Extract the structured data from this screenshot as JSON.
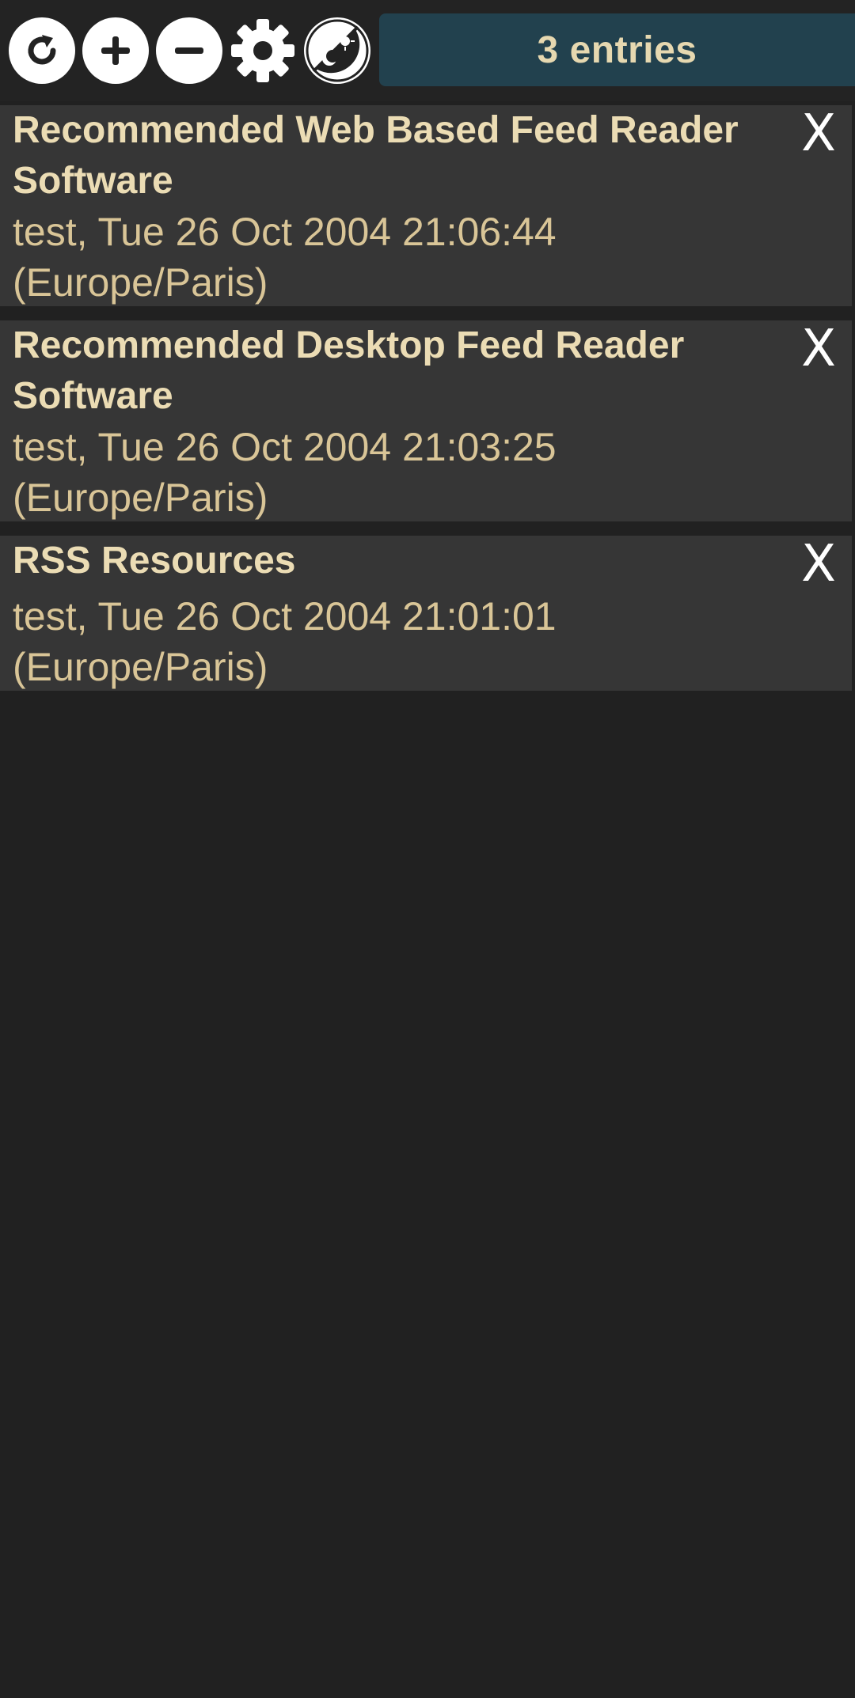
{
  "toolbar": {
    "entries_label": "3 entries",
    "buttons": [
      {
        "name": "refresh",
        "icon": "refresh-icon"
      },
      {
        "name": "add",
        "icon": "plus-icon"
      },
      {
        "name": "remove",
        "icon": "minus-icon"
      },
      {
        "name": "settings",
        "icon": "gear-icon"
      },
      {
        "name": "theme",
        "icon": "theme-toggle-icon"
      }
    ]
  },
  "entries": [
    {
      "title": "Recommended Web Based Feed Reader Software",
      "meta": "test, Tue 26 Oct 2004 21:06:44 (Europe/Paris)",
      "close_label": "X"
    },
    {
      "title": "Recommended Desktop Feed Reader Software",
      "meta": "test, Tue 26 Oct 2004 21:03:25 (Europe/Paris)",
      "close_label": "X"
    },
    {
      "title": "RSS Resources",
      "meta": "test, Tue 26 Oct 2004 21:01:01 (Europe/Paris)",
      "close_label": "X"
    }
  ],
  "colors": {
    "background": "#212121",
    "entry_background": "#363636",
    "badge_background": "#22414e",
    "title_text": "#ebdcb4",
    "meta_text": "#d9c597"
  }
}
